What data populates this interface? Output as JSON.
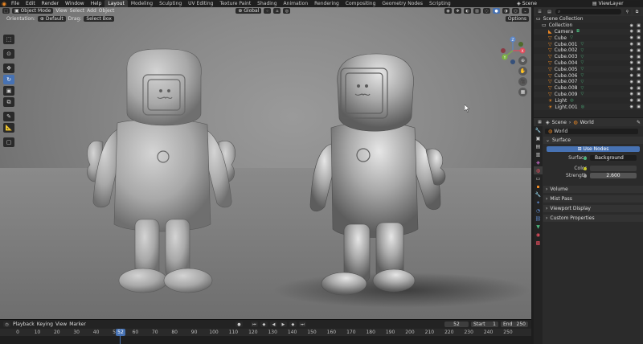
{
  "topbar": {
    "menus": [
      "File",
      "Edit",
      "Render",
      "Window",
      "Help"
    ],
    "workspaces": [
      "Layout",
      "Modeling",
      "Sculpting",
      "UV Editing",
      "Texture Paint",
      "Shading",
      "Animation",
      "Rendering",
      "Compositing",
      "Geometry Nodes",
      "Scripting"
    ],
    "active_workspace": "Layout",
    "scene": "Scene",
    "view_layer": "ViewLayer"
  },
  "viewport": {
    "mode": "Object Mode",
    "menus": [
      "View",
      "Select",
      "Add",
      "Object"
    ],
    "orientation_label": "Orientation:",
    "orientation": "Default",
    "drag_label": "Drag:",
    "drag": "Select Box",
    "transform_space": "Global",
    "options": "Options",
    "gizmo_axes": {
      "x": "X",
      "y": "Y",
      "z": "Z"
    }
  },
  "outliner": {
    "search_placeholder": "",
    "rows": [
      {
        "name": "Scene Collection",
        "type": "collection"
      },
      {
        "name": "Collection",
        "type": "collection"
      },
      {
        "name": "Camera",
        "type": "camera"
      },
      {
        "name": "Cube",
        "type": "mesh"
      },
      {
        "name": "Cube.001",
        "type": "mesh"
      },
      {
        "name": "Cube.002",
        "type": "mesh"
      },
      {
        "name": "Cube.003",
        "type": "mesh"
      },
      {
        "name": "Cube.004",
        "type": "mesh"
      },
      {
        "name": "Cube.005",
        "type": "mesh"
      },
      {
        "name": "Cube.006",
        "type": "mesh"
      },
      {
        "name": "Cube.007",
        "type": "mesh"
      },
      {
        "name": "Cube.008",
        "type": "mesh"
      },
      {
        "name": "Cube.009",
        "type": "mesh"
      },
      {
        "name": "Light",
        "type": "light"
      },
      {
        "name": "Light.001",
        "type": "light"
      }
    ]
  },
  "properties": {
    "breadcrumb_scene": "Scene",
    "breadcrumb_world": "World",
    "world_name": "World",
    "surface_panel": "Surface",
    "use_nodes": "Use Nodes",
    "surface_label": "Surface",
    "surface_value": "Background",
    "color_label": "Color",
    "strength_label": "Strength",
    "strength_value": "2.600",
    "collapsed_panels": [
      "Volume",
      "Mist Pass",
      "Viewport Display",
      "Custom Properties"
    ]
  },
  "timeline": {
    "menus": [
      "Playback",
      "Keying",
      "View",
      "Marker"
    ],
    "current_frame": "52",
    "start_label": "Start",
    "start": "1",
    "end_label": "End",
    "end": "250",
    "ticks": [
      "0",
      "10",
      "20",
      "30",
      "40",
      "50",
      "60",
      "70",
      "80",
      "90",
      "100",
      "110",
      "120",
      "130",
      "140",
      "150",
      "160",
      "170",
      "180",
      "190",
      "200",
      "210",
      "220",
      "230",
      "240",
      "250"
    ]
  },
  "colors": {
    "accent": "#4772b3",
    "orange": "#f08a24",
    "green": "#4ab57c"
  }
}
